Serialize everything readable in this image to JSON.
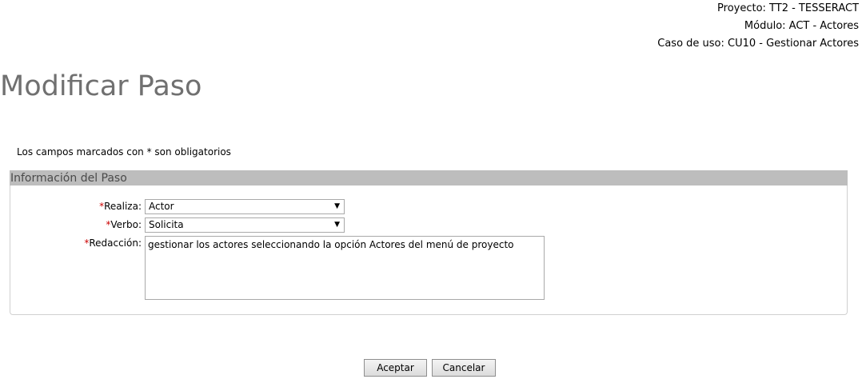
{
  "context": {
    "project": "Proyecto: TT2 - TESSERACT",
    "module": "Módulo: ACT - Actores",
    "use_case": "Caso de uso: CU10 - Gestionar Actores"
  },
  "page_title": "Modificar Paso",
  "required_note": "Los campos marcados con * son obligatorios",
  "section": {
    "legend": "Información del Paso",
    "required_mark": "*",
    "fields": {
      "realiza": {
        "label": "Realiza:",
        "value": "Actor"
      },
      "verbo": {
        "label": "Verbo:",
        "value": "Solicita"
      },
      "redaccion": {
        "label": "Redacción:",
        "value": "gestionar los actores seleccionando la opción Actores del menú de proyecto"
      }
    },
    "dropdown_icon": "▼"
  },
  "buttons": {
    "accept": "Aceptar",
    "cancel": "Cancelar"
  }
}
